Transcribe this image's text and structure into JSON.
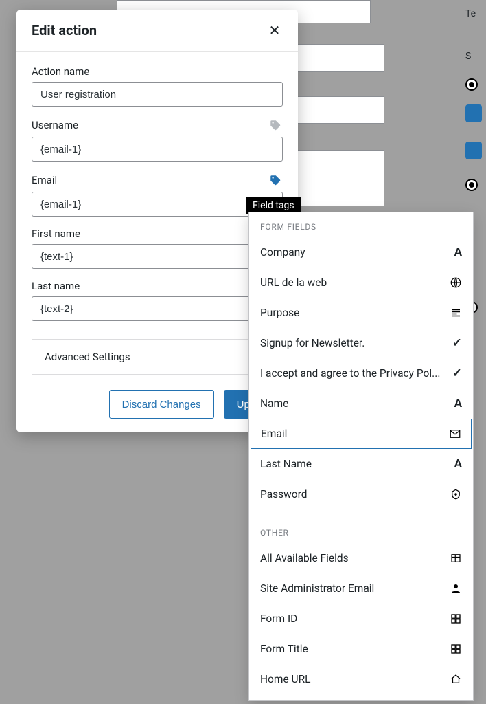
{
  "modal": {
    "title": "Edit action",
    "fields": {
      "action_name": {
        "label": "Action name",
        "value": "User registration"
      },
      "username": {
        "label": "Username",
        "value": "{email-1}"
      },
      "email": {
        "label": "Email",
        "value": "{email-1}"
      },
      "first_name": {
        "label": "First name",
        "value": "{text-1}"
      },
      "last_name": {
        "label": "Last name",
        "value": "{text-2}"
      }
    },
    "advanced_label": "Advanced Settings",
    "buttons": {
      "discard": "Discard Changes",
      "update": "Update"
    }
  },
  "tooltip": "Field tags",
  "dropdown": {
    "sections": {
      "form_fields_title": "FORM FIELDS",
      "other_title": "OTHER"
    },
    "form_fields": [
      {
        "label": "Company",
        "icon": "A"
      },
      {
        "label": "URL de la web",
        "icon": "globe"
      },
      {
        "label": "Purpose",
        "icon": "lines"
      },
      {
        "label": "Signup for Newsletter.",
        "icon": "check"
      },
      {
        "label": "I accept and agree to the Privacy Pol...",
        "icon": "check"
      },
      {
        "label": "Name",
        "icon": "A"
      },
      {
        "label": "Email",
        "icon": "mail",
        "selected": true
      },
      {
        "label": "Last Name",
        "icon": "A"
      },
      {
        "label": "Password",
        "icon": "lock"
      }
    ],
    "other": [
      {
        "label": "All Available Fields",
        "icon": "table"
      },
      {
        "label": "Site Administrator Email",
        "icon": "user"
      },
      {
        "label": "Form ID",
        "icon": "grid"
      },
      {
        "label": "Form Title",
        "icon": "grid"
      },
      {
        "label": "Home URL",
        "icon": "home"
      }
    ]
  }
}
